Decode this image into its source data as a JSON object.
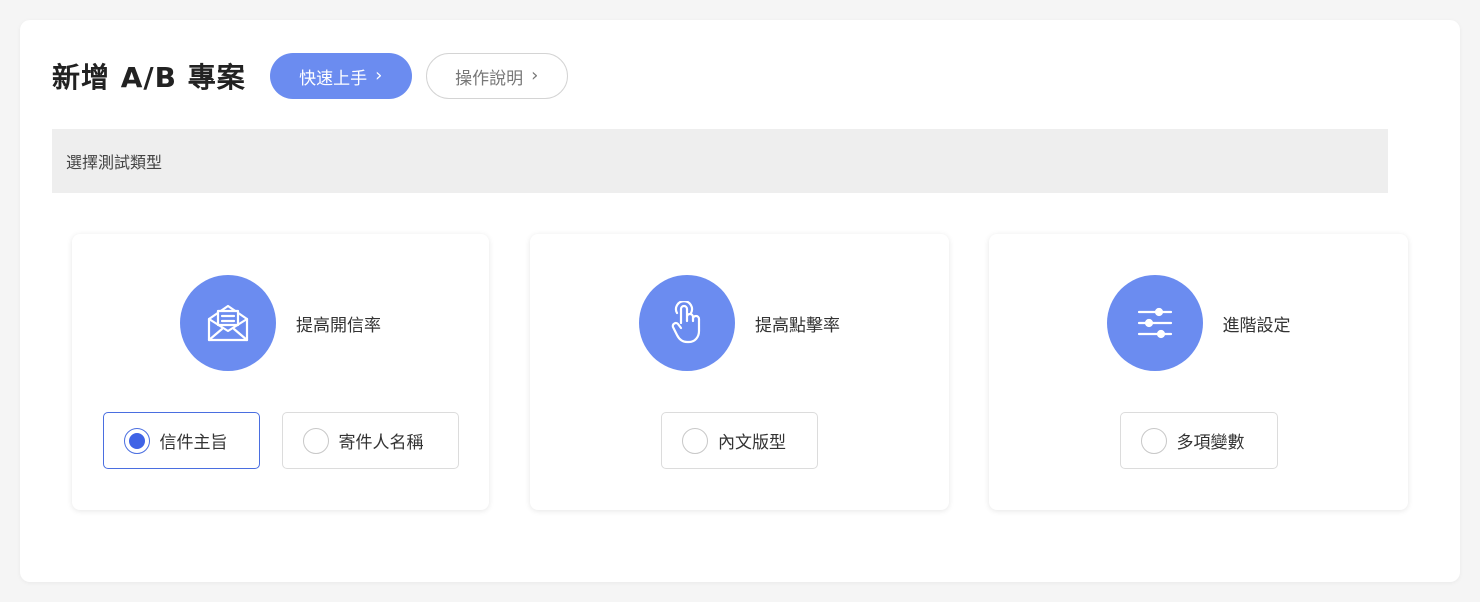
{
  "header": {
    "title": "新增 A/B 專案",
    "quick_start_label": "快速上手",
    "help_label": "操作說明"
  },
  "section": {
    "label": "選擇測試類型"
  },
  "cards": [
    {
      "title": "提高開信率",
      "icon": "open-envelope-icon",
      "options": [
        {
          "label": "信件主旨",
          "selected": true
        },
        {
          "label": "寄件人名稱",
          "selected": false
        }
      ]
    },
    {
      "title": "提高點擊率",
      "icon": "pointer-hand-icon",
      "options": [
        {
          "label": "內文版型",
          "selected": false
        }
      ]
    },
    {
      "title": "進階設定",
      "icon": "sliders-icon",
      "options": [
        {
          "label": "多項變數",
          "selected": false
        }
      ]
    }
  ],
  "colors": {
    "accent": "#6b8cf0",
    "selected_border": "#4a6ee0",
    "section_bg": "#eeeeee"
  }
}
